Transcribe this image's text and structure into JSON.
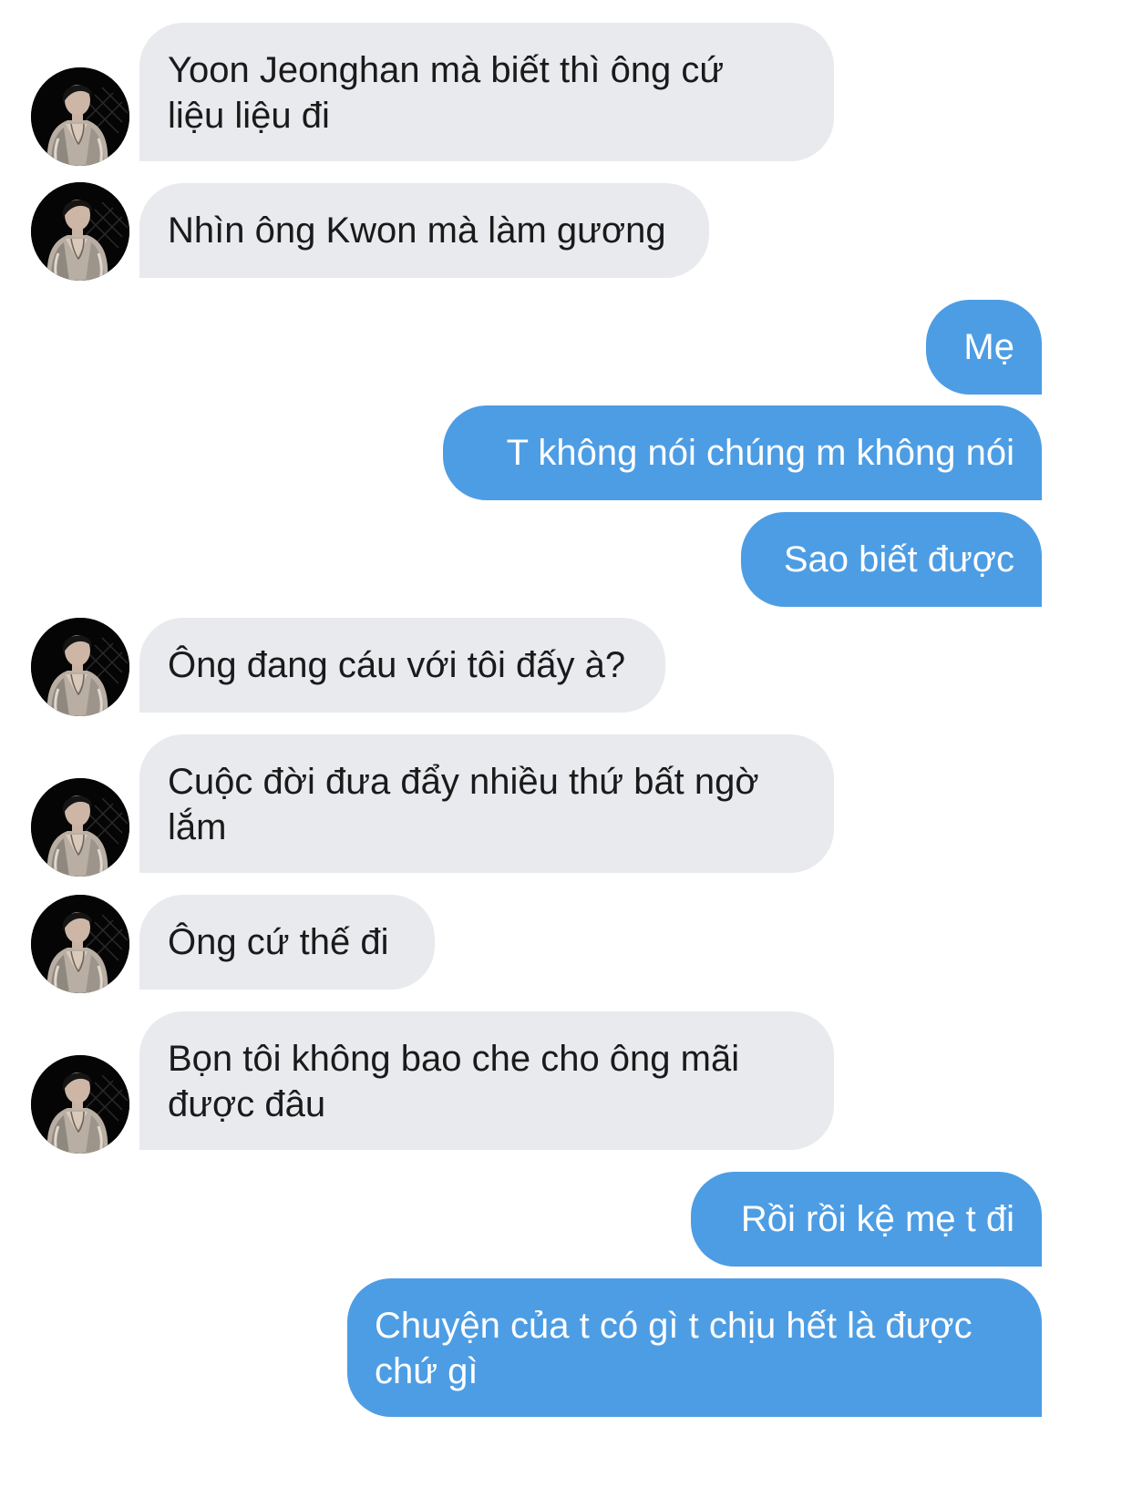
{
  "conversation": {
    "messages": [
      {
        "sender": "them",
        "lines": [
          "Yoon Jeonghan mà biết thì ông cứ",
          "liệu liệu đi"
        ]
      },
      {
        "sender": "them",
        "lines": [
          "Nhìn ông Kwon mà làm gương"
        ]
      },
      {
        "sender": "me",
        "lines": [
          "Mẹ"
        ]
      },
      {
        "sender": "me",
        "lines": [
          "T không nói chúng m không nói"
        ]
      },
      {
        "sender": "me",
        "lines": [
          "Sao biết được"
        ]
      },
      {
        "sender": "them",
        "lines": [
          "Ông đang cáu với tôi đấy à?"
        ]
      },
      {
        "sender": "them",
        "lines": [
          "Cuộc đời đưa đẩy nhiều thứ bất ngờ",
          "lắm"
        ]
      },
      {
        "sender": "them",
        "lines": [
          "Ông cứ thế đi"
        ]
      },
      {
        "sender": "them",
        "lines": [
          "Bọn tôi không bao che cho ông mãi",
          "được đâu"
        ]
      },
      {
        "sender": "me",
        "lines": [
          "Rồi rồi kệ mẹ t đi"
        ]
      },
      {
        "sender": "me",
        "lines": [
          "Chuyện của t có gì t chịu hết là được",
          "chứ gì"
        ]
      }
    ]
  },
  "colors": {
    "incoming_bubble": "#e9eaee",
    "incoming_text": "#1a1a1a",
    "outgoing_bubble": "#4d9de4",
    "outgoing_text": "#ffffff",
    "avatar_background": "#050505"
  },
  "icons": {
    "avatar": "contact-photo"
  }
}
